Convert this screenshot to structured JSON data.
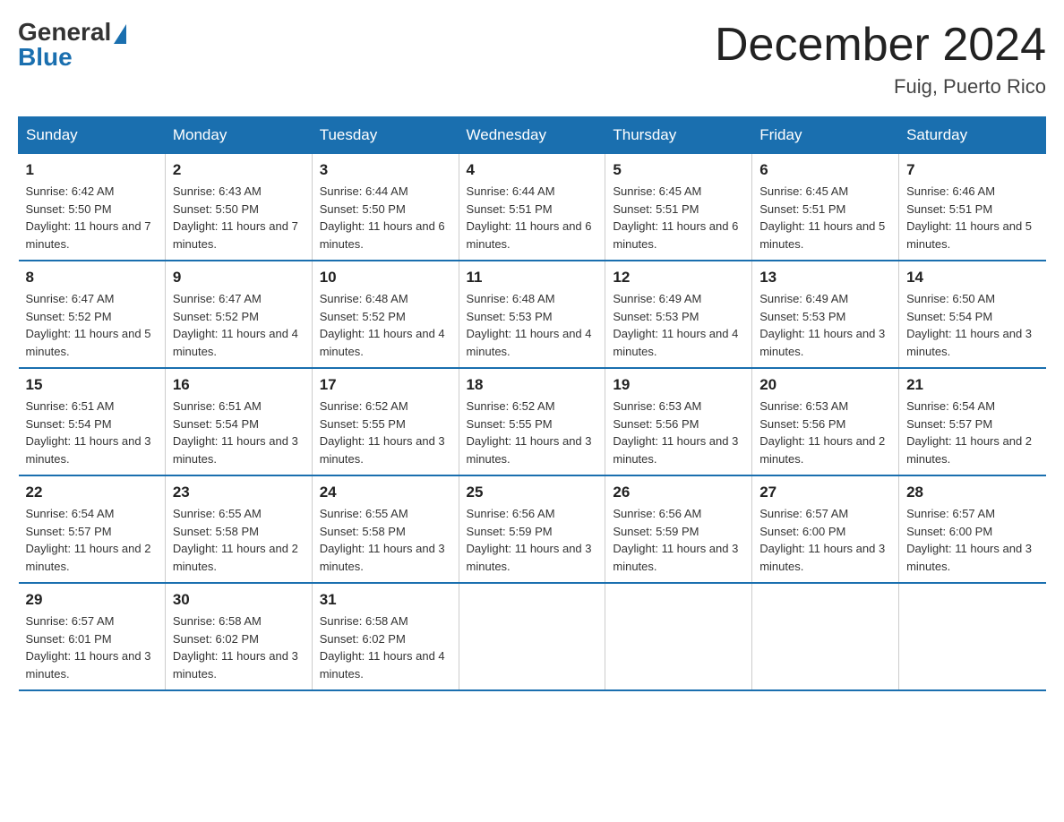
{
  "header": {
    "logo": {
      "general": "General",
      "blue": "Blue",
      "triangle_color": "#1a6faf"
    },
    "title": "December 2024",
    "location": "Fuig, Puerto Rico"
  },
  "calendar": {
    "days_of_week": [
      "Sunday",
      "Monday",
      "Tuesday",
      "Wednesday",
      "Thursday",
      "Friday",
      "Saturday"
    ],
    "weeks": [
      [
        {
          "day": "1",
          "sunrise": "6:42 AM",
          "sunset": "5:50 PM",
          "daylight": "11 hours and 7 minutes."
        },
        {
          "day": "2",
          "sunrise": "6:43 AM",
          "sunset": "5:50 PM",
          "daylight": "11 hours and 7 minutes."
        },
        {
          "day": "3",
          "sunrise": "6:44 AM",
          "sunset": "5:50 PM",
          "daylight": "11 hours and 6 minutes."
        },
        {
          "day": "4",
          "sunrise": "6:44 AM",
          "sunset": "5:51 PM",
          "daylight": "11 hours and 6 minutes."
        },
        {
          "day": "5",
          "sunrise": "6:45 AM",
          "sunset": "5:51 PM",
          "daylight": "11 hours and 6 minutes."
        },
        {
          "day": "6",
          "sunrise": "6:45 AM",
          "sunset": "5:51 PM",
          "daylight": "11 hours and 5 minutes."
        },
        {
          "day": "7",
          "sunrise": "6:46 AM",
          "sunset": "5:51 PM",
          "daylight": "11 hours and 5 minutes."
        }
      ],
      [
        {
          "day": "8",
          "sunrise": "6:47 AM",
          "sunset": "5:52 PM",
          "daylight": "11 hours and 5 minutes."
        },
        {
          "day": "9",
          "sunrise": "6:47 AM",
          "sunset": "5:52 PM",
          "daylight": "11 hours and 4 minutes."
        },
        {
          "day": "10",
          "sunrise": "6:48 AM",
          "sunset": "5:52 PM",
          "daylight": "11 hours and 4 minutes."
        },
        {
          "day": "11",
          "sunrise": "6:48 AM",
          "sunset": "5:53 PM",
          "daylight": "11 hours and 4 minutes."
        },
        {
          "day": "12",
          "sunrise": "6:49 AM",
          "sunset": "5:53 PM",
          "daylight": "11 hours and 4 minutes."
        },
        {
          "day": "13",
          "sunrise": "6:49 AM",
          "sunset": "5:53 PM",
          "daylight": "11 hours and 3 minutes."
        },
        {
          "day": "14",
          "sunrise": "6:50 AM",
          "sunset": "5:54 PM",
          "daylight": "11 hours and 3 minutes."
        }
      ],
      [
        {
          "day": "15",
          "sunrise": "6:51 AM",
          "sunset": "5:54 PM",
          "daylight": "11 hours and 3 minutes."
        },
        {
          "day": "16",
          "sunrise": "6:51 AM",
          "sunset": "5:54 PM",
          "daylight": "11 hours and 3 minutes."
        },
        {
          "day": "17",
          "sunrise": "6:52 AM",
          "sunset": "5:55 PM",
          "daylight": "11 hours and 3 minutes."
        },
        {
          "day": "18",
          "sunrise": "6:52 AM",
          "sunset": "5:55 PM",
          "daylight": "11 hours and 3 minutes."
        },
        {
          "day": "19",
          "sunrise": "6:53 AM",
          "sunset": "5:56 PM",
          "daylight": "11 hours and 3 minutes."
        },
        {
          "day": "20",
          "sunrise": "6:53 AM",
          "sunset": "5:56 PM",
          "daylight": "11 hours and 2 minutes."
        },
        {
          "day": "21",
          "sunrise": "6:54 AM",
          "sunset": "5:57 PM",
          "daylight": "11 hours and 2 minutes."
        }
      ],
      [
        {
          "day": "22",
          "sunrise": "6:54 AM",
          "sunset": "5:57 PM",
          "daylight": "11 hours and 2 minutes."
        },
        {
          "day": "23",
          "sunrise": "6:55 AM",
          "sunset": "5:58 PM",
          "daylight": "11 hours and 2 minutes."
        },
        {
          "day": "24",
          "sunrise": "6:55 AM",
          "sunset": "5:58 PM",
          "daylight": "11 hours and 3 minutes."
        },
        {
          "day": "25",
          "sunrise": "6:56 AM",
          "sunset": "5:59 PM",
          "daylight": "11 hours and 3 minutes."
        },
        {
          "day": "26",
          "sunrise": "6:56 AM",
          "sunset": "5:59 PM",
          "daylight": "11 hours and 3 minutes."
        },
        {
          "day": "27",
          "sunrise": "6:57 AM",
          "sunset": "6:00 PM",
          "daylight": "11 hours and 3 minutes."
        },
        {
          "day": "28",
          "sunrise": "6:57 AM",
          "sunset": "6:00 PM",
          "daylight": "11 hours and 3 minutes."
        }
      ],
      [
        {
          "day": "29",
          "sunrise": "6:57 AM",
          "sunset": "6:01 PM",
          "daylight": "11 hours and 3 minutes."
        },
        {
          "day": "30",
          "sunrise": "6:58 AM",
          "sunset": "6:02 PM",
          "daylight": "11 hours and 3 minutes."
        },
        {
          "day": "31",
          "sunrise": "6:58 AM",
          "sunset": "6:02 PM",
          "daylight": "11 hours and 4 minutes."
        },
        {
          "day": "",
          "sunrise": "",
          "sunset": "",
          "daylight": ""
        },
        {
          "day": "",
          "sunrise": "",
          "sunset": "",
          "daylight": ""
        },
        {
          "day": "",
          "sunrise": "",
          "sunset": "",
          "daylight": ""
        },
        {
          "day": "",
          "sunrise": "",
          "sunset": "",
          "daylight": ""
        }
      ]
    ]
  }
}
